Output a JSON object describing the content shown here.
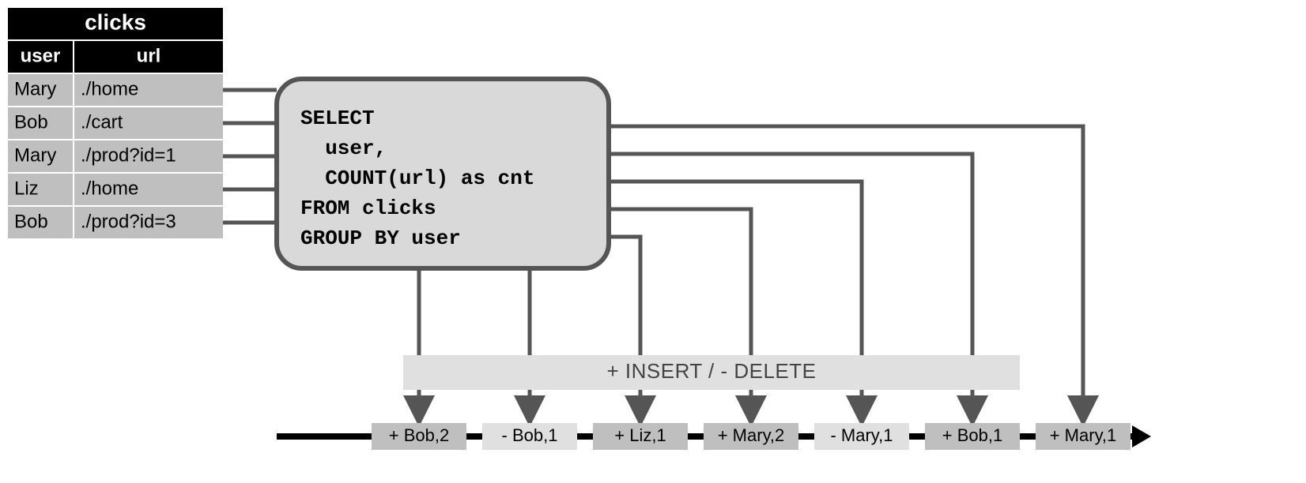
{
  "table": {
    "title": "clicks",
    "columns": [
      "user",
      "url"
    ],
    "rows": [
      {
        "user": "Mary",
        "url": "./home"
      },
      {
        "user": "Bob",
        "url": "./cart"
      },
      {
        "user": "Mary",
        "url": "./prod?id=1"
      },
      {
        "user": "Liz",
        "url": "./home"
      },
      {
        "user": "Bob",
        "url": "./prod?id=3"
      }
    ]
  },
  "query": {
    "lines": [
      "SELECT",
      "  user,",
      "  COUNT(url) as cnt",
      "FROM clicks",
      "GROUP BY user"
    ]
  },
  "banner": {
    "label": "+ INSERT / - DELETE"
  },
  "stream": {
    "events": [
      {
        "text": "+ Bob,2",
        "kind": "insert"
      },
      {
        "text": "- Bob,1",
        "kind": "delete"
      },
      {
        "text": "+ Liz,1",
        "kind": "insert"
      },
      {
        "text": "+ Mary,2",
        "kind": "insert"
      },
      {
        "text": "- Mary,1",
        "kind": "delete"
      },
      {
        "text": "+ Bob,1",
        "kind": "insert"
      },
      {
        "text": "+ Mary,1",
        "kind": "insert"
      }
    ]
  },
  "colors": {
    "black": "#000000",
    "cell": "#bfbfbf",
    "panel_fill": "#d9d9d9",
    "panel_stroke": "#555555",
    "banner_fill": "#e0e0e0",
    "insert_fill": "#bfbfbf",
    "delete_fill": "#e0e0e0"
  }
}
